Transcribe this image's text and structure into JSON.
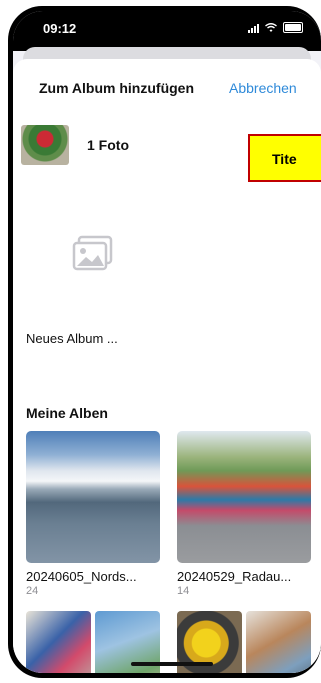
{
  "status_bar": {
    "time": "09:12"
  },
  "header": {
    "title": "Zum Album hinzufügen",
    "cancel_label": "Abbrechen"
  },
  "selection": {
    "count_label": "1 Foto"
  },
  "new_album": {
    "label": "Neues Album ..."
  },
  "tooltip": {
    "text": "Tite"
  },
  "albums_section": {
    "title": "Meine Alben",
    "albums": [
      {
        "name": "20240605_Nords...",
        "count": "24"
      },
      {
        "name": "20240529_Radau...",
        "count": "14"
      }
    ]
  },
  "colors": {
    "accent": "#2f8ad9",
    "tooltip_bg": "#ffff00",
    "tooltip_border": "#c00000"
  }
}
